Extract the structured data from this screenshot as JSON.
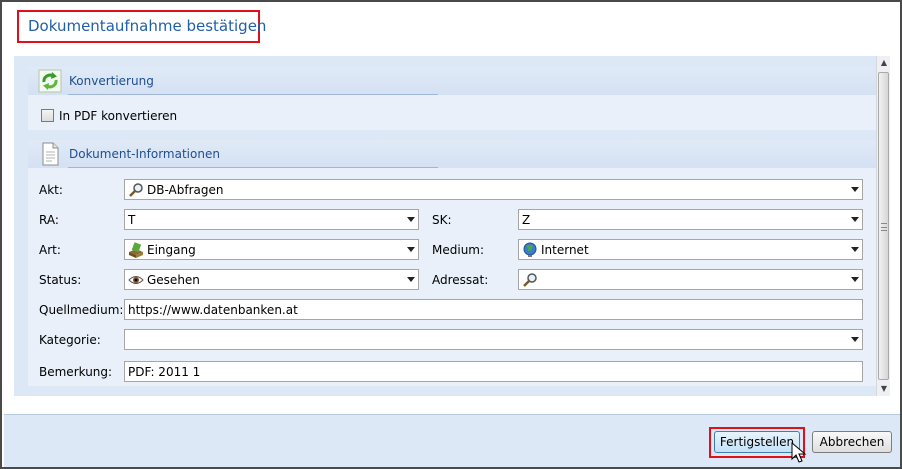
{
  "dialog": {
    "title": "Dokumentaufnahme bestätigen"
  },
  "conversion": {
    "section_title": "Konvertierung",
    "icon": "recycle-arrows-icon",
    "checkbox_label": "In PDF konvertieren",
    "checked": false
  },
  "doc_info": {
    "section_title": "Dokument-Informationen",
    "icon": "document-icon",
    "akt": {
      "label": "Akt:",
      "value": "DB-Abfragen",
      "icon": "magnifier-icon"
    },
    "ra": {
      "label": "RA:",
      "value": "T"
    },
    "sk": {
      "label": "SK:",
      "value": "Z"
    },
    "art": {
      "label": "Art:",
      "value": "Eingang",
      "icon": "inbox-icon"
    },
    "medium": {
      "label": "Medium:",
      "value": "Internet",
      "icon": "globe-icon"
    },
    "status": {
      "label": "Status:",
      "value": "Gesehen",
      "icon": "eye-icon"
    },
    "adressat": {
      "label": "Adressat:",
      "value": "",
      "icon": "magnifier-icon"
    },
    "quellmedium": {
      "label": "Quellmedium:",
      "value": "https://www.datenbanken.at"
    },
    "kategorie": {
      "label": "Kategorie:",
      "value": ""
    },
    "bemerkung": {
      "label": "Bemerkung:",
      "value": "PDF: 2011 1"
    }
  },
  "buttons": {
    "finish": "Fertigstellen",
    "cancel": "Abbrechen"
  },
  "colors": {
    "highlight": "#e0101a",
    "title_text": "#2060a8",
    "panel_bg": "#dde8f6"
  }
}
